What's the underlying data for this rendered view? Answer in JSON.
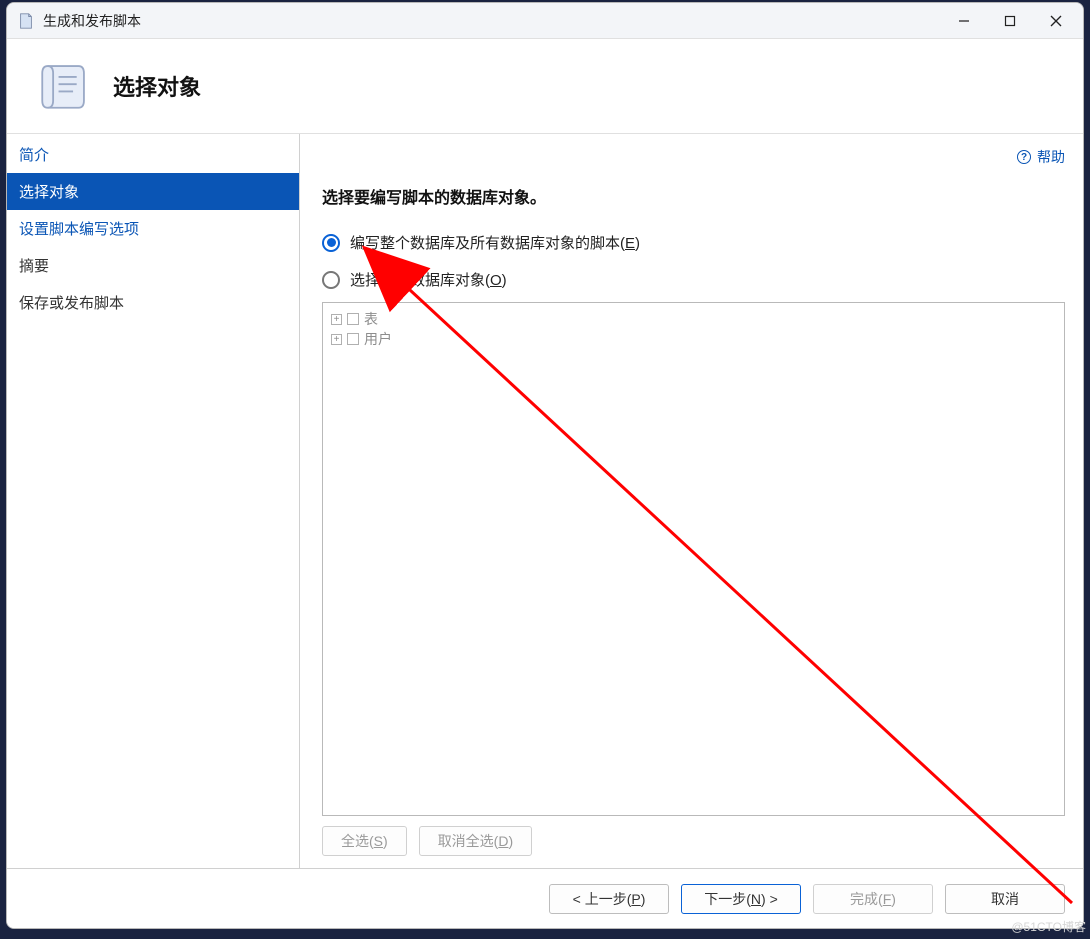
{
  "titlebar": {
    "title": "生成和发布脚本"
  },
  "header": {
    "title": "选择对象"
  },
  "sidebar": {
    "items": [
      {
        "label": "简介",
        "state": "link"
      },
      {
        "label": "选择对象",
        "state": "selected"
      },
      {
        "label": "设置脚本编写选项",
        "state": "link"
      },
      {
        "label": "摘要",
        "state": "plain"
      },
      {
        "label": "保存或发布脚本",
        "state": "plain"
      }
    ]
  },
  "content": {
    "help_label": "帮助",
    "instruction": "选择要编写脚本的数据库对象。",
    "radios": [
      {
        "text": "编写整个数据库及所有数据库对象的脚本(",
        "hotkey": "E",
        "suffix": ")",
        "checked": true
      },
      {
        "text": "选择特定数据库对象(",
        "hotkey": "O",
        "suffix": ")",
        "checked": false
      }
    ],
    "tree": [
      {
        "label": "表"
      },
      {
        "label": "用户"
      }
    ],
    "select_all": {
      "text": "全选(",
      "hotkey": "S",
      "suffix": ")"
    },
    "deselect_all": {
      "text": "取消全选(",
      "hotkey": "D",
      "suffix": ")"
    }
  },
  "footer": {
    "back": {
      "prefix": "< 上一步(",
      "hotkey": "P",
      "suffix": ")"
    },
    "next": {
      "prefix": "下一步(",
      "hotkey": "N",
      "suffix": ") >"
    },
    "finish": {
      "prefix": "完成(",
      "hotkey": "F",
      "suffix": ")"
    },
    "cancel": "取消"
  },
  "watermark": "@51CTO博客"
}
